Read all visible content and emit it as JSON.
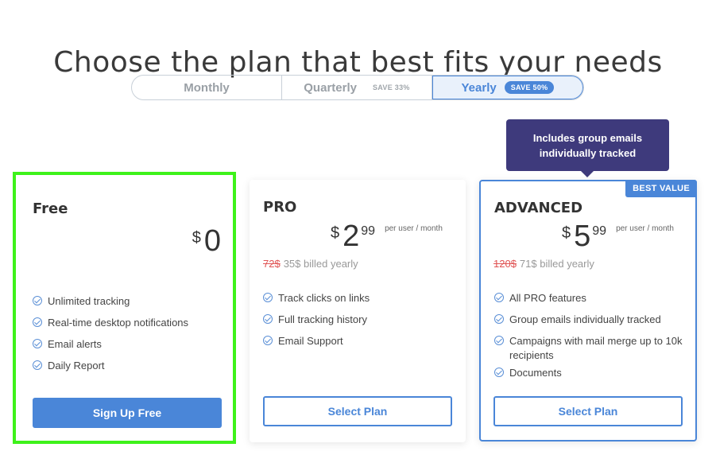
{
  "header": {
    "title": "Choose the plan that best fits your needs"
  },
  "billing_toggle": {
    "options": [
      {
        "label": "Monthly",
        "save": ""
      },
      {
        "label": "Quarterly",
        "save": "SAVE 33%"
      },
      {
        "label": "Yearly",
        "save": "SAVE 50%"
      }
    ],
    "selected": "Yearly"
  },
  "tooltip": {
    "line1": "Includes group emails",
    "line2": "individually tracked"
  },
  "plans": [
    {
      "name": "Free",
      "currency": "$",
      "amount": "0",
      "cents": "",
      "per": "",
      "old_price": "",
      "billed": "",
      "features": [
        "Unlimited tracking",
        "Real-time desktop notifications",
        "Email alerts",
        "Daily Report"
      ],
      "button": "Sign Up Free"
    },
    {
      "name": "PRO",
      "currency": "$",
      "amount": "2",
      "cents": "99",
      "per": "per user / month",
      "old_price": "72$",
      "billed": "35$ billed yearly",
      "features": [
        "Track clicks on links",
        "Full tracking history",
        "Email Support"
      ],
      "button": "Select Plan"
    },
    {
      "name": "ADVANCED",
      "badge": "BEST VALUE",
      "currency": "$",
      "amount": "5",
      "cents": "99",
      "per": "per user / month",
      "old_price": "120$",
      "billed": "71$ billed yearly",
      "features": [
        "All PRO features",
        "Group emails individually tracked",
        "Campaigns with mail merge up to 10k recipients",
        "Documents"
      ],
      "button": "Select Plan"
    }
  ],
  "colors": {
    "accent": "#4a86d8",
    "tooltip_bg": "#3e3a7c",
    "highlight": "#3ef21a",
    "strike": "#e05555"
  }
}
